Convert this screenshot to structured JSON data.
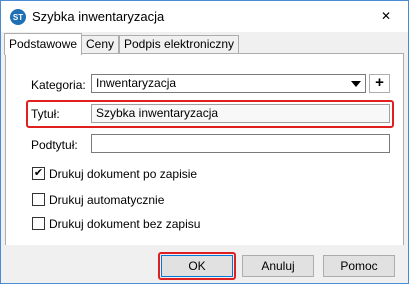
{
  "window": {
    "title": "Szybka inwentaryzacja",
    "icon": "app-logo-icon",
    "icon_text": "ST",
    "close_glyph": "✕"
  },
  "tabs": [
    {
      "label": "Podstawowe",
      "active": true
    },
    {
      "label": "Ceny",
      "active": false
    },
    {
      "label": "Podpis elektroniczny",
      "active": false
    }
  ],
  "form": {
    "kategoria_label": "Kategoria:",
    "kategoria_value": "Inwentaryzacja",
    "add_label": "+",
    "tytul_label": "Tytuł:",
    "tytul_value": "Szybka inwentaryzacja",
    "podtytul_label": "Podtytuł:",
    "podtytul_value": ""
  },
  "options": [
    {
      "label": "Drukuj dokument po zapisie",
      "checked": true
    },
    {
      "label": "Drukuj automatycznie",
      "checked": false
    },
    {
      "label": "Drukuj dokument bez zapisu",
      "checked": false
    }
  ],
  "check_glyph": "✔",
  "buttons": {
    "ok": "OK",
    "cancel": "Anuluj",
    "help": "Pomoc"
  },
  "colors": {
    "highlight": "#e02020",
    "accent": "#0078d7"
  }
}
